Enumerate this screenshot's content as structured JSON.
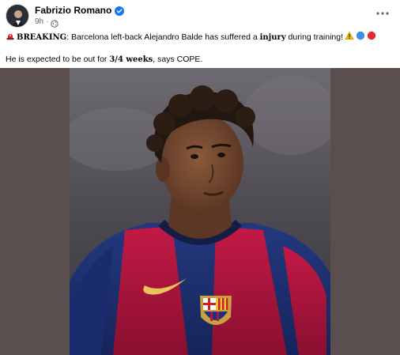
{
  "post": {
    "author": "Fabrizio Romano",
    "timestamp": "9h",
    "separator": "·",
    "verified_icon": "verified-badge-icon",
    "privacy_icon": "globe-icon",
    "more_icon": "more-options-icon",
    "line1": {
      "lead_emoji": "siren-icon",
      "strong": "BREAKING",
      "text_a": ": Barcelona left-back Alejandro Balde has suffered a ",
      "strong2": "injury",
      "text_b": " during training! ",
      "trail_emojis": [
        "warning-icon",
        "blue-circle-icon",
        "red-circle-icon"
      ]
    },
    "line2": {
      "text_a": "He is expected to be out for ",
      "strong": "3/4 weeks",
      "text_b": ", says COPE."
    },
    "photo": {
      "subject": "player-photo",
      "background_color": "#5a4e4e"
    }
  },
  "colors": {
    "accent_blue": "#1877f2",
    "text_primary": "#050505",
    "text_secondary": "#65676b",
    "media_bg": "#5a4e4e",
    "jersey_red": "#b0173d",
    "jersey_blue": "#1c2f7a"
  }
}
